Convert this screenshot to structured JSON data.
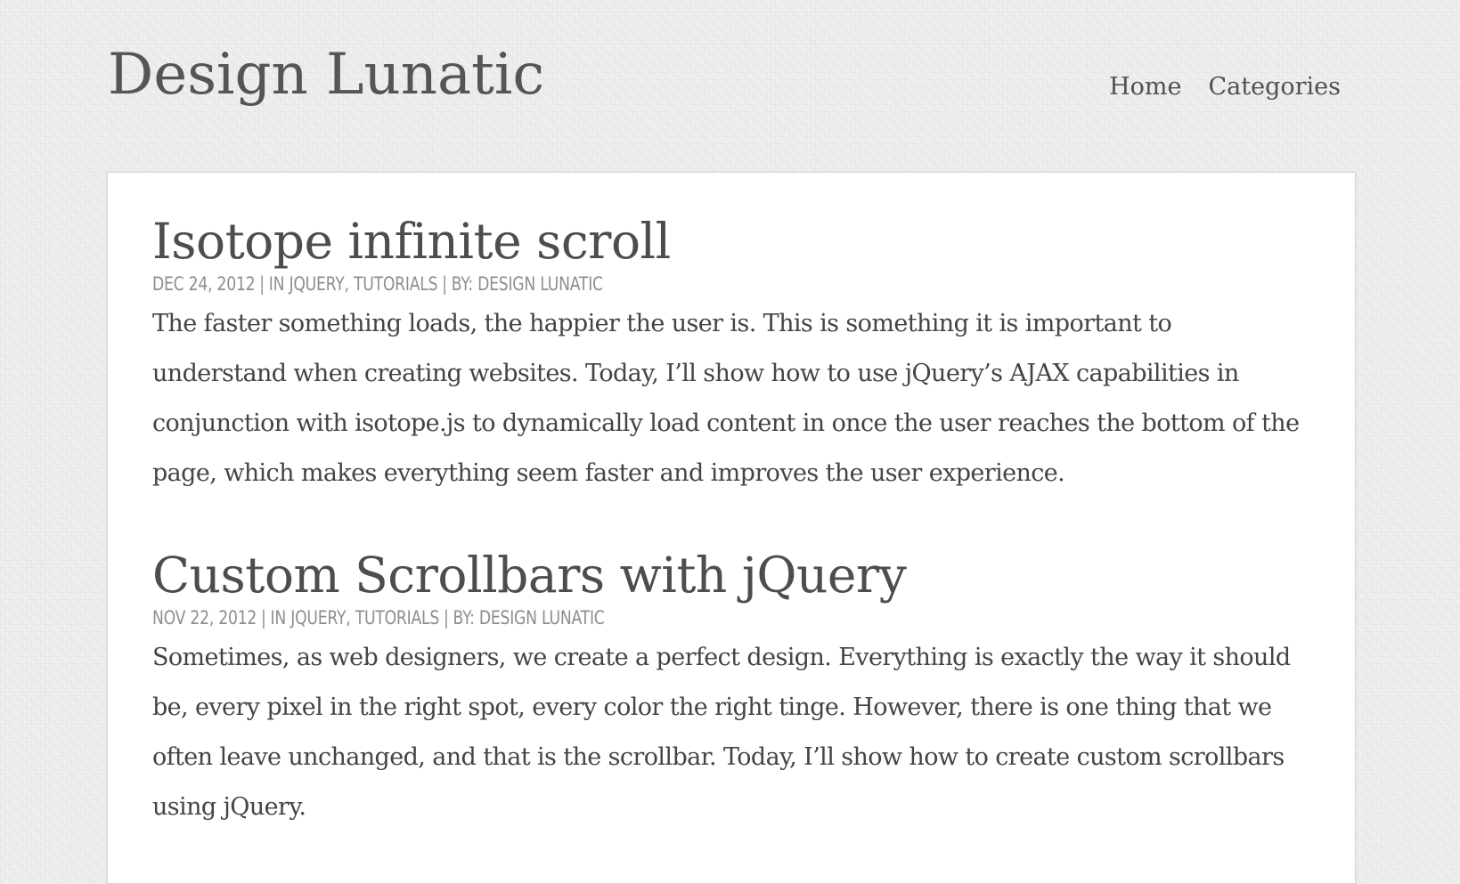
{
  "site": {
    "title": "Design Lunatic"
  },
  "nav": {
    "items": [
      {
        "label": "Home"
      },
      {
        "label": "Categories"
      }
    ]
  },
  "posts": [
    {
      "title": "Isotope infinite scroll",
      "date": "Dec 24, 2012",
      "in_prefix": "In",
      "categories": "jQuery, Tutorials",
      "by_prefix": "By:",
      "author": "Design Lunatic",
      "excerpt": "The faster something loads, the happier the user is. This is something it is important to understand when creating websites. Today, I’ll show how to use jQuery’s AJAX capabilities in conjunction with isotope.js to dynamically load content in once the user reaches the bottom of the page, which makes everything seem faster and improves the user experience."
    },
    {
      "title": "Custom Scrollbars with jQuery",
      "date": "Nov 22, 2012",
      "in_prefix": "In",
      "categories": "jQuery, Tutorials",
      "by_prefix": "By:",
      "author": "Design Lunatic",
      "excerpt": "Sometimes, as web designers, we create a perfect design. Everything is exactly the way it should be, every pixel in the right spot, every color the right tinge. However, there is one thing that we often leave unchanged, and that is the scrollbar. Today, I’ll show how to create custom scrollbars using jQuery."
    }
  ],
  "separators": {
    "meta": "|"
  }
}
